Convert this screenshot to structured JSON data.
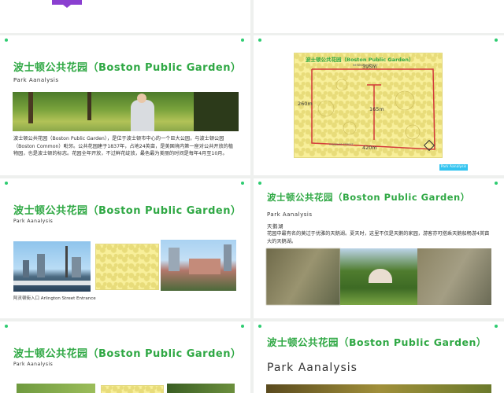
{
  "slides": {
    "s2": {
      "title": "波士顿公共花园（Boston Public Garden）",
      "subtitle": "Park Aanalysis",
      "body": "波士顿公共花园（Boston Public Garden），是位于波士顿市中心的一个巨大公园，与波士顿公园（Boston Common）毗邻。公共花园建于1837年，占地24英亩，是美国境内第一座对公共开放的植物园，也是波士顿的标志。花园全年开放，不过鲜花绽放，最色最为美丽的时间是每年4月至10月。"
    },
    "s3": {
      "map_title": "波士顿公共花园（Boston Public Garden）",
      "street_top": "NEWBURY STREET",
      "street_bottom": "CHARLES STREET",
      "dim_top": "395m",
      "dim_left": "260m",
      "dim_center": "165m",
      "dim_bottom": "420m",
      "tag": "Park Aanalysis"
    },
    "s4": {
      "title": "波士顿公共花园（Boston Public Garden）",
      "subtitle": "Park Aanalysis",
      "caption": "阿灵顿街入口 Arlington Street Entrance"
    },
    "s5": {
      "title": "波士顿公共花园（Boston Public Garden）",
      "subtitle": "Park Aanalysis",
      "heading": "天鹅湖",
      "body": "花园中最有名的莫过于优雅的天鹅湖。夏天时，这里不仅是天鹅的家园，游客亦可搭乘天鹅船畅游4英亩大的天鹅湖。"
    },
    "s6": {
      "title": "波士顿公共花园（Boston Public Garden）",
      "subtitle": "Park Aanalysis"
    },
    "s7": {
      "title": "波士顿公共花园（Boston Public Garden）",
      "subtitle": "Park Aanalysis"
    }
  },
  "colors": {
    "accent_green": "#2fa844",
    "map_yellow": "#f8ef9a",
    "boundary_red": "#d33a3a",
    "tag_blue": "#33c4f0",
    "purple": "#8a3fd0"
  }
}
